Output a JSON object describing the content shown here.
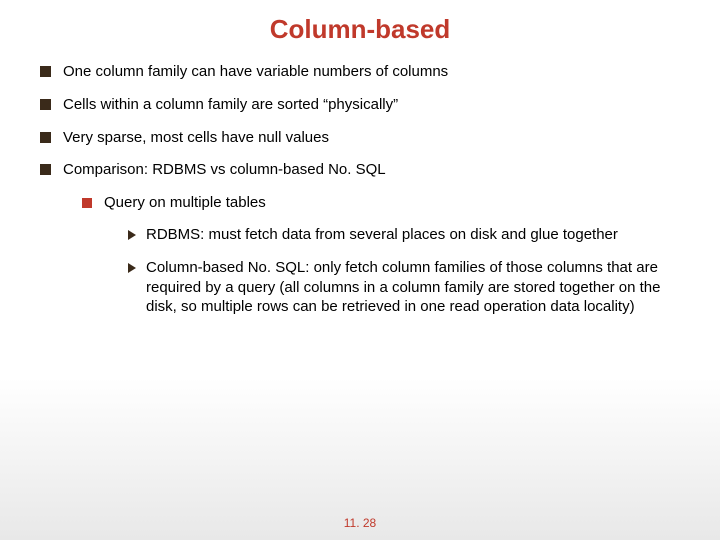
{
  "title": "Column-based",
  "bullets": {
    "b1": "One column family can have variable numbers of columns",
    "b2": "Cells within a column family are sorted “physically”",
    "b3": "Very sparse, most cells have null values",
    "b4": "Comparison: RDBMS vs column-based No. SQL",
    "sub1": "Query on multiple tables",
    "subsub1": "RDBMS: must fetch data from several places on disk and glue together",
    "subsub2": "Column-based No. SQL: only fetch column families of those columns that are required by a query (all columns in a column family are stored together on the disk, so multiple rows can be retrieved in one read operation data locality)"
  },
  "slide_number": "11. 28"
}
